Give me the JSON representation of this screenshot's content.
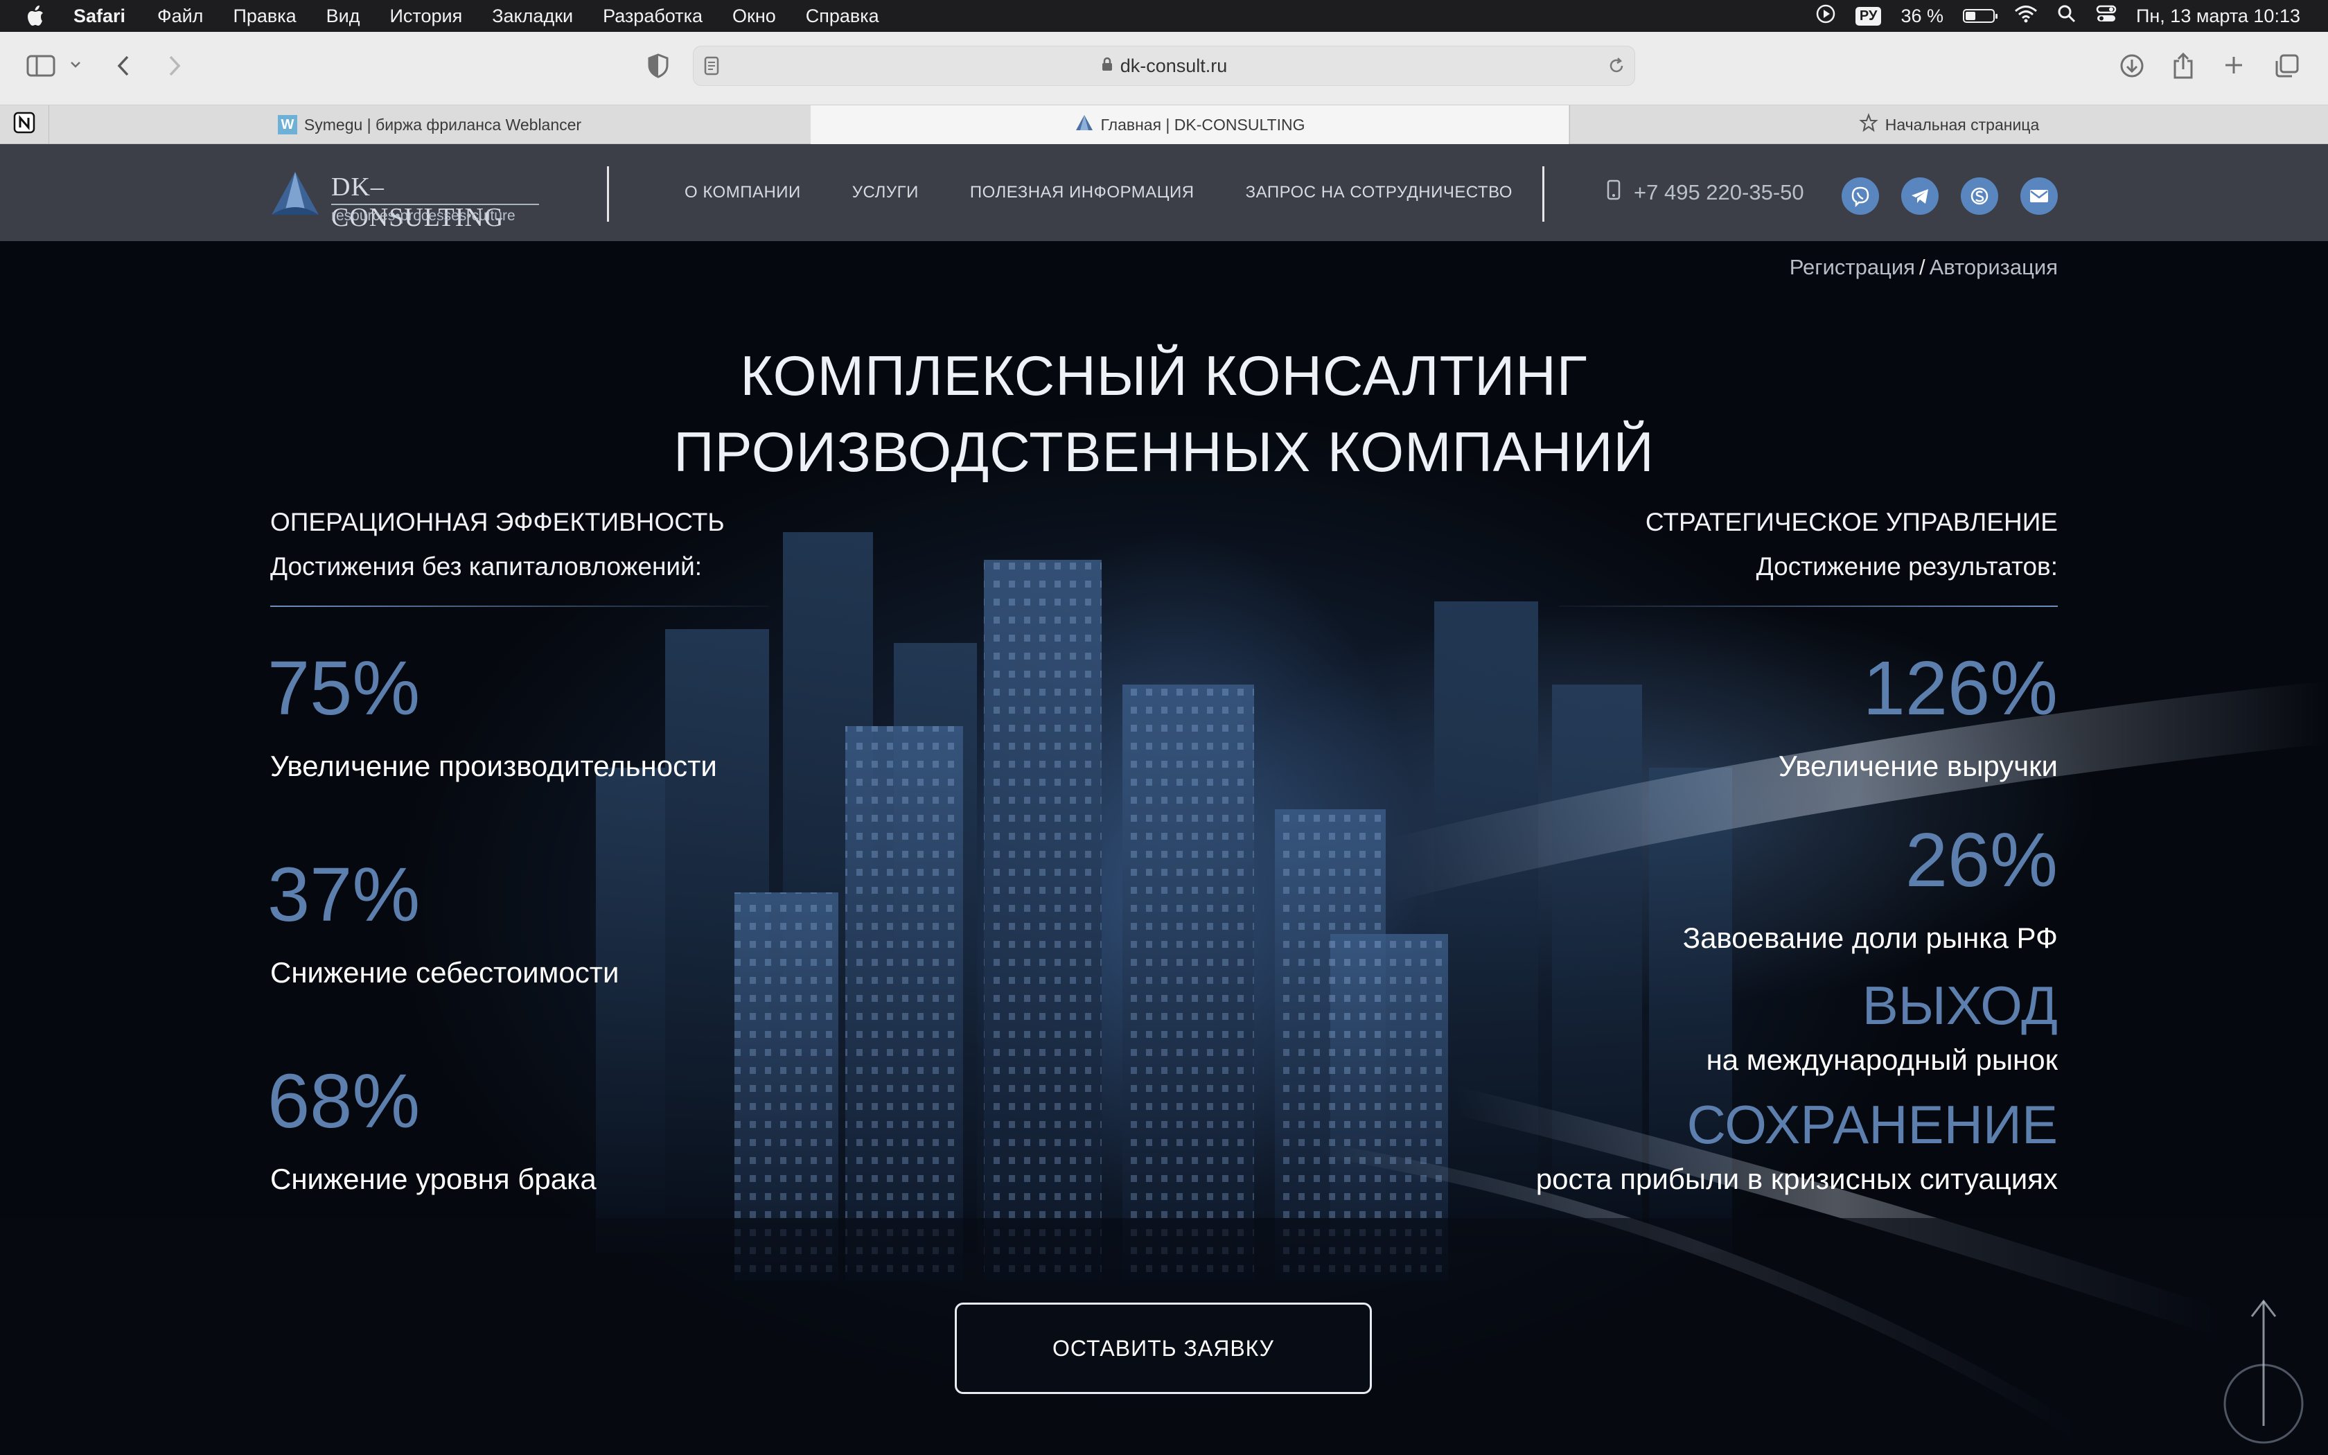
{
  "menubar": {
    "app": "Safari",
    "items": [
      "Файл",
      "Правка",
      "Вид",
      "История",
      "Закладки",
      "Разработка",
      "Окно",
      "Справка"
    ],
    "keyboard": "РУ",
    "battery": "36 %",
    "battery_level": 0.36,
    "datetime": "Пн, 13 марта  10:13"
  },
  "browser": {
    "url": "dk-consult.ru",
    "tabs": [
      {
        "label": "Symegu | биржа фриланса Weblancer",
        "favicon": "W"
      },
      {
        "label": "Главная | DK-CONSULTING",
        "favicon": "dk-logo-icon"
      },
      {
        "label": "Начальная страница",
        "favicon": "star-icon"
      }
    ]
  },
  "site": {
    "logo": {
      "name": "DK–CONSULTING",
      "tagline": "resources•processes•culture"
    },
    "nav": [
      "О КОМПАНИИ",
      "УСЛУГИ",
      "ПОЛЕЗНАЯ ИНФОРМАЦИЯ",
      "ЗАПРОС НА СОТРУДНИЧЕСТВО"
    ],
    "phone": "+7 495 220-35-50",
    "social": [
      "viber-icon",
      "telegram-icon",
      "skype-icon",
      "mail-icon"
    ],
    "auth": {
      "register": "Регистрация",
      "separator": "/",
      "login": "Авторизация"
    },
    "hero": {
      "title_line1": "КОМПЛЕКСНЫЙ КОНСАЛТИНГ",
      "title_line2": "ПРОИЗВОДСТВЕННЫХ КОМПАНИЙ"
    },
    "left": {
      "heading": "ОПЕРАЦИОННАЯ ЭФФЕКТИВНОСТЬ",
      "subheading": "Достижения без капиталовложений:",
      "stats": [
        {
          "value": "75%",
          "label": "Увеличение производительности"
        },
        {
          "value": "37%",
          "label": "Снижение себестоимости"
        },
        {
          "value": "68%",
          "label": "Снижение уровня брака"
        }
      ]
    },
    "right": {
      "heading": "СТРАТЕГИЧЕСКОЕ УПРАВЛЕНИЕ",
      "subheading": "Достижение результатов:",
      "stats": [
        {
          "value": "126%",
          "label": "Увеличение выручки"
        },
        {
          "value": "26%",
          "label": "Завоевание доли рынка РФ"
        },
        {
          "value": "ВЫХОД",
          "label": "на международный рынок"
        },
        {
          "value": "СОХРАНЕНИЕ",
          "label": "роста прибыли в кризисных ситуациях"
        }
      ]
    },
    "cta": "ОСТАВИТЬ ЗАЯВКУ",
    "accent_color": "#5d7fae"
  }
}
